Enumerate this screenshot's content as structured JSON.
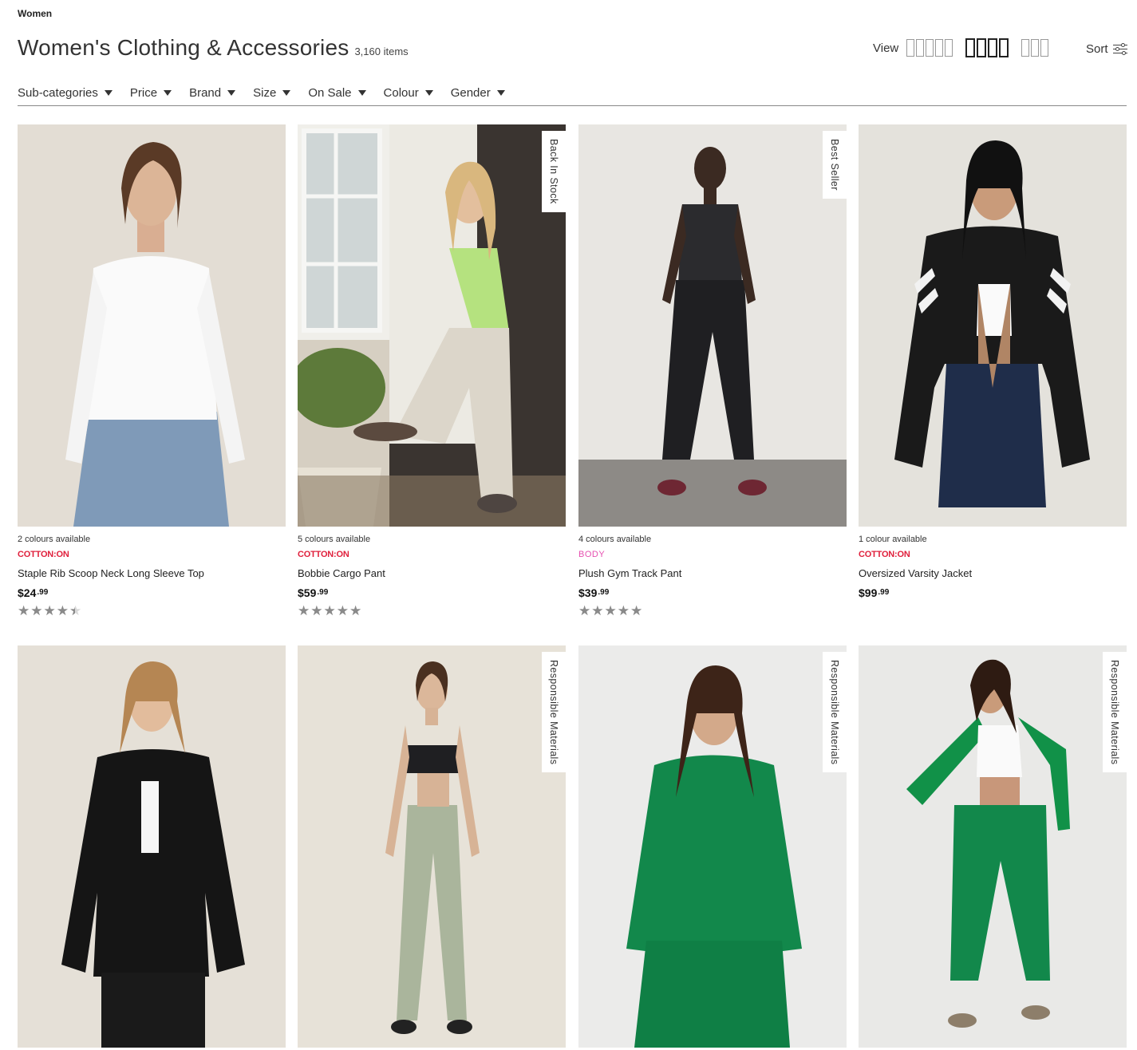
{
  "breadcrumb": "Women",
  "header": {
    "title": "Women's Clothing & Accessories",
    "count": "3,160 items"
  },
  "view": {
    "label": "View"
  },
  "sort": {
    "label": "Sort"
  },
  "filters": [
    "Sub-categories",
    "Price",
    "Brand",
    "Size",
    "On Sale",
    "Colour",
    "Gender"
  ],
  "colors": {
    "brand_cotton_on": "#e0203c",
    "brand_body": "#e64fb0",
    "rating_star": "#8a8a8a"
  },
  "products": [
    {
      "colours": "2 colours available",
      "brand": "COTTON:ON",
      "name": "Staple Rib Scoop Neck Long Sleeve Top",
      "price_main": "$24",
      "price_cents": ".99",
      "rating": 4.0
    },
    {
      "colours": "5 colours available",
      "brand": "COTTON:ON",
      "name": "Bobbie Cargo Pant",
      "price_main": "$59",
      "price_cents": ".99",
      "rating": 4.5,
      "badge": "Back In Stock"
    },
    {
      "colours": "4 colours available",
      "brand": "BODY",
      "name": "Plush Gym Track Pant",
      "price_main": "$39",
      "price_cents": ".99",
      "rating": 4.4,
      "badge": "Best Seller"
    },
    {
      "colours": "1 colour available",
      "brand": "COTTON:ON",
      "name": "Oversized Varsity Jacket",
      "price_main": "$99",
      "price_cents": ".99"
    },
    {},
    {
      "badge": "Responsible Materials"
    },
    {
      "badge": "Responsible Materials"
    },
    {
      "badge": "Responsible Materials"
    }
  ]
}
